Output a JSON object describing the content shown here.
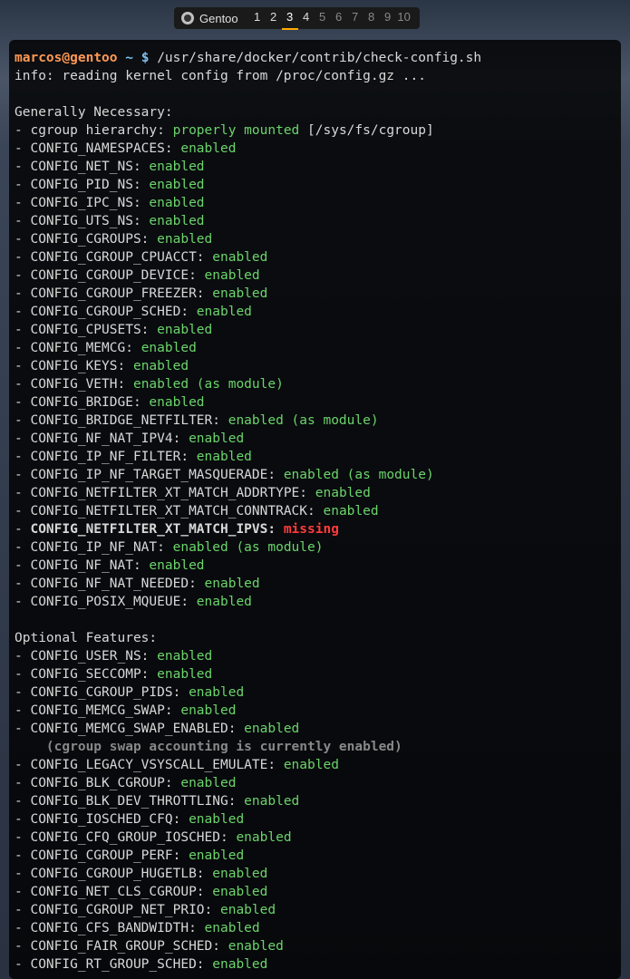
{
  "tabbar": {
    "title": "Gentoo",
    "tabs": [
      "1",
      "2",
      "3",
      "4",
      "5",
      "6",
      "7",
      "8",
      "9",
      "10"
    ],
    "active": 3,
    "visited": [
      1,
      2,
      3,
      4
    ]
  },
  "prompt": {
    "user": "marcos",
    "at": "@",
    "host": "gentoo",
    "path": "~",
    "dollar": "$",
    "command": "/usr/share/docker/contrib/check-config.sh"
  },
  "info_line": "info: reading kernel config from /proc/config.gz ...",
  "section1_header": "Generally Necessary:",
  "section1": [
    {
      "label": "cgroup hierarchy:",
      "status": "properly mounted",
      "suffix": "[/sys/fs/cgroup]"
    },
    {
      "label": "CONFIG_NAMESPACES:",
      "status": "enabled"
    },
    {
      "label": "CONFIG_NET_NS:",
      "status": "enabled"
    },
    {
      "label": "CONFIG_PID_NS:",
      "status": "enabled"
    },
    {
      "label": "CONFIG_IPC_NS:",
      "status": "enabled"
    },
    {
      "label": "CONFIG_UTS_NS:",
      "status": "enabled"
    },
    {
      "label": "CONFIG_CGROUPS:",
      "status": "enabled"
    },
    {
      "label": "CONFIG_CGROUP_CPUACCT:",
      "status": "enabled"
    },
    {
      "label": "CONFIG_CGROUP_DEVICE:",
      "status": "enabled"
    },
    {
      "label": "CONFIG_CGROUP_FREEZER:",
      "status": "enabled"
    },
    {
      "label": "CONFIG_CGROUP_SCHED:",
      "status": "enabled"
    },
    {
      "label": "CONFIG_CPUSETS:",
      "status": "enabled"
    },
    {
      "label": "CONFIG_MEMCG:",
      "status": "enabled"
    },
    {
      "label": "CONFIG_KEYS:",
      "status": "enabled"
    },
    {
      "label": "CONFIG_VETH:",
      "status": "enabled (as module)"
    },
    {
      "label": "CONFIG_BRIDGE:",
      "status": "enabled"
    },
    {
      "label": "CONFIG_BRIDGE_NETFILTER:",
      "status": "enabled (as module)"
    },
    {
      "label": "CONFIG_NF_NAT_IPV4:",
      "status": "enabled"
    },
    {
      "label": "CONFIG_IP_NF_FILTER:",
      "status": "enabled"
    },
    {
      "label": "CONFIG_IP_NF_TARGET_MASQUERADE:",
      "status": "enabled (as module)"
    },
    {
      "label": "CONFIG_NETFILTER_XT_MATCH_ADDRTYPE:",
      "status": "enabled"
    },
    {
      "label": "CONFIG_NETFILTER_XT_MATCH_CONNTRACK:",
      "status": "enabled"
    },
    {
      "label": "CONFIG_NETFILTER_XT_MATCH_IPVS:",
      "status": "missing",
      "missing": true,
      "boldlabel": true
    },
    {
      "label": "CONFIG_IP_NF_NAT:",
      "status": "enabled (as module)"
    },
    {
      "label": "CONFIG_NF_NAT:",
      "status": "enabled"
    },
    {
      "label": "CONFIG_NF_NAT_NEEDED:",
      "status": "enabled"
    },
    {
      "label": "CONFIG_POSIX_MQUEUE:",
      "status": "enabled"
    }
  ],
  "section2_header": "Optional Features:",
  "section2": [
    {
      "label": "CONFIG_USER_NS:",
      "status": "enabled"
    },
    {
      "label": "CONFIG_SECCOMP:",
      "status": "enabled"
    },
    {
      "label": "CONFIG_CGROUP_PIDS:",
      "status": "enabled"
    },
    {
      "label": "CONFIG_MEMCG_SWAP:",
      "status": "enabled"
    },
    {
      "label": "CONFIG_MEMCG_SWAP_ENABLED:",
      "status": "enabled",
      "note": "(cgroup swap accounting is currently enabled)"
    },
    {
      "label": "CONFIG_LEGACY_VSYSCALL_EMULATE:",
      "status": "enabled"
    },
    {
      "label": "CONFIG_BLK_CGROUP:",
      "status": "enabled"
    },
    {
      "label": "CONFIG_BLK_DEV_THROTTLING:",
      "status": "enabled"
    },
    {
      "label": "CONFIG_IOSCHED_CFQ:",
      "status": "enabled"
    },
    {
      "label": "CONFIG_CFQ_GROUP_IOSCHED:",
      "status": "enabled"
    },
    {
      "label": "CONFIG_CGROUP_PERF:",
      "status": "enabled"
    },
    {
      "label": "CONFIG_CGROUP_HUGETLB:",
      "status": "enabled"
    },
    {
      "label": "CONFIG_NET_CLS_CGROUP:",
      "status": "enabled"
    },
    {
      "label": "CONFIG_CGROUP_NET_PRIO:",
      "status": "enabled"
    },
    {
      "label": "CONFIG_CFS_BANDWIDTH:",
      "status": "enabled"
    },
    {
      "label": "CONFIG_FAIR_GROUP_SCHED:",
      "status": "enabled"
    },
    {
      "label": "CONFIG_RT_GROUP_SCHED:",
      "status": "enabled"
    }
  ]
}
